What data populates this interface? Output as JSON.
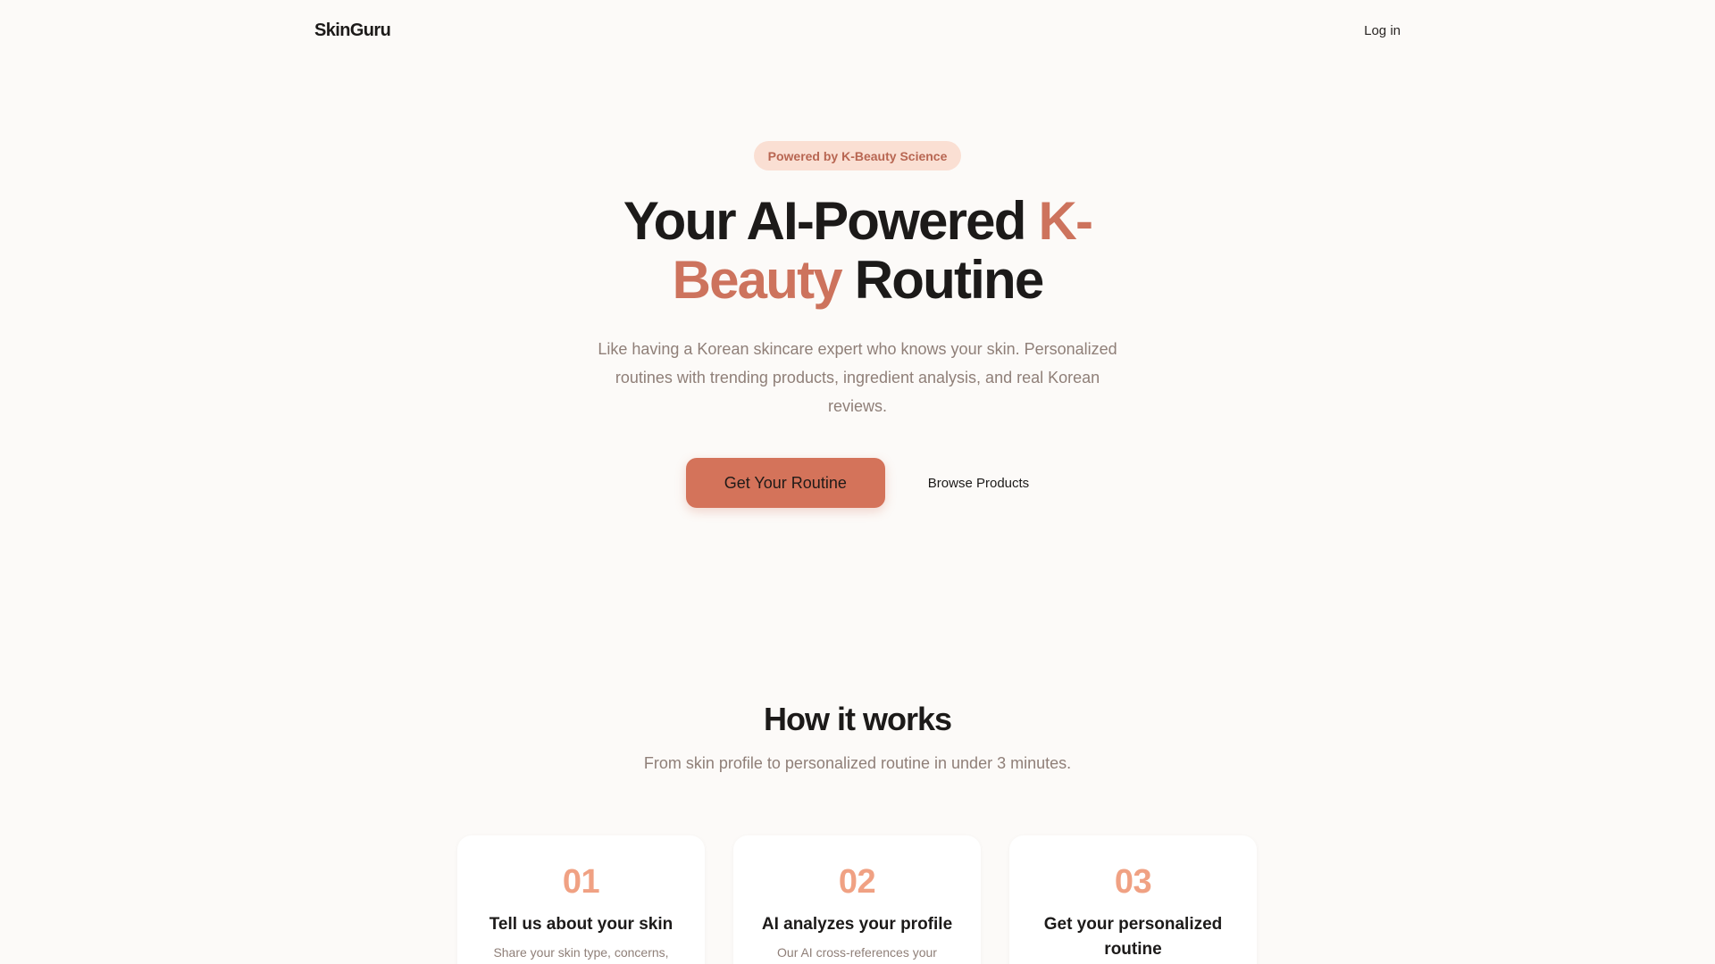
{
  "nav": {
    "brand": "SkinGuru",
    "login_label": "Log in"
  },
  "hero": {
    "badge": "Powered by K-Beauty Science",
    "headline_part1": "Your AI-Powered ",
    "headline_accent": "K-Beauty",
    "headline_part2": " Routine",
    "subtitle": "Like having a Korean skincare expert who knows your skin. Personalized routines with trending products, ingredient analysis, and real Korean reviews.",
    "primary_cta": "Get Your Routine",
    "secondary_cta": "Browse Products"
  },
  "how_it_works": {
    "title": "How it works",
    "subtitle": "From skin profile to personalized routine in under 3 minutes.",
    "steps": [
      {
        "number": "01",
        "title": "Tell us about your skin",
        "desc": "Share your skin type, concerns,"
      },
      {
        "number": "02",
        "title": "AI analyzes your profile",
        "desc": "Our AI cross-references your"
      },
      {
        "number": "03",
        "title": "Get your personalized routine",
        "desc": ""
      }
    ]
  },
  "colors": {
    "accent": "#cd735d",
    "primary_button": "#d4735a",
    "step_number": "#f0a183",
    "badge_bg": "#fadfd3",
    "background": "#fcfaf8"
  }
}
